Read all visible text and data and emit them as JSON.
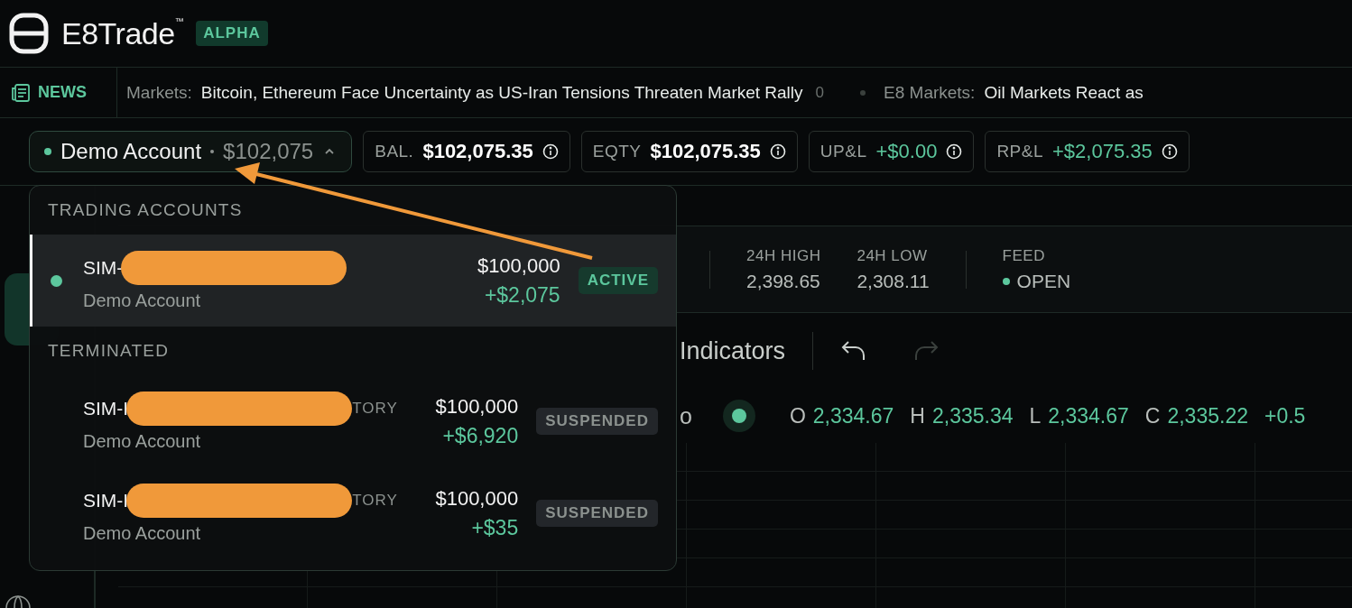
{
  "header": {
    "brand": "E8Trade$^{™}$",
    "badge": "ALPHA"
  },
  "news": {
    "label": "NEWS",
    "items": [
      {
        "source": "Markets:",
        "headline": "Bitcoin, Ethereum Face Uncertainty as US-Iran Tensions Threaten Market Rally",
        "count": "0"
      },
      {
        "source": "E8 Markets:",
        "headline": "Oil Markets React as"
      }
    ]
  },
  "account_bar": {
    "account": {
      "name": "Demo Account",
      "value": "$102,075",
      "expanded": true
    },
    "metrics": [
      {
        "label": "BAL.",
        "value": "$102,075.35",
        "kind": "neutral"
      },
      {
        "label": "EQTY",
        "value": "$102,075.35",
        "kind": "neutral"
      },
      {
        "label": "UP&L",
        "value": "+$0.00",
        "kind": "gain"
      },
      {
        "label": "RP&L",
        "value": "+$2,075.35",
        "kind": "gain"
      }
    ]
  },
  "account_menu": {
    "sections": [
      {
        "title": "TRADING ACCOUNTS",
        "accounts": [
          {
            "name": "SIM-",
            "redacted": true,
            "type": "Demo Account",
            "balance": "$100,000",
            "pnl": "+$2,075",
            "status": "ACTIVE",
            "kind": "active",
            "selected": true
          }
        ]
      },
      {
        "title": "TERMINATED",
        "accounts": [
          {
            "name": "SIM-I",
            "redacted": true,
            "suffix": "TORY",
            "type": "Demo Account",
            "balance": "$100,000",
            "pnl": "+$6,920",
            "status": "SUSPENDED",
            "kind": "suspended",
            "selected": false
          },
          {
            "name": "SIM-I",
            "redacted": true,
            "suffix": "TORY",
            "type": "Demo Account",
            "balance": "$100,000",
            "pnl": "+$35",
            "status": "SUSPENDED",
            "kind": "suspended",
            "selected": false
          }
        ]
      }
    ]
  },
  "stats": [
    {
      "label": "24H HIGH",
      "value": "2,398.65",
      "kind": "number"
    },
    {
      "label": "24H LOW",
      "value": "2,308.11",
      "kind": "number"
    },
    {
      "label": "FEED",
      "value": "OPEN",
      "kind": "status"
    }
  ],
  "toolbar": {
    "indicators": "Indicators",
    "undo_disabled": false,
    "redo_disabled": true
  },
  "ohlc": {
    "symbol_tail": "o",
    "live": true,
    "fields": [
      {
        "label": "O",
        "value": "2,334.67"
      },
      {
        "label": "H",
        "value": "2,335.34"
      },
      {
        "label": "L",
        "value": "2,334.67"
      },
      {
        "label": "C",
        "value": "2,335.22"
      }
    ],
    "change": "+0.5"
  }
}
